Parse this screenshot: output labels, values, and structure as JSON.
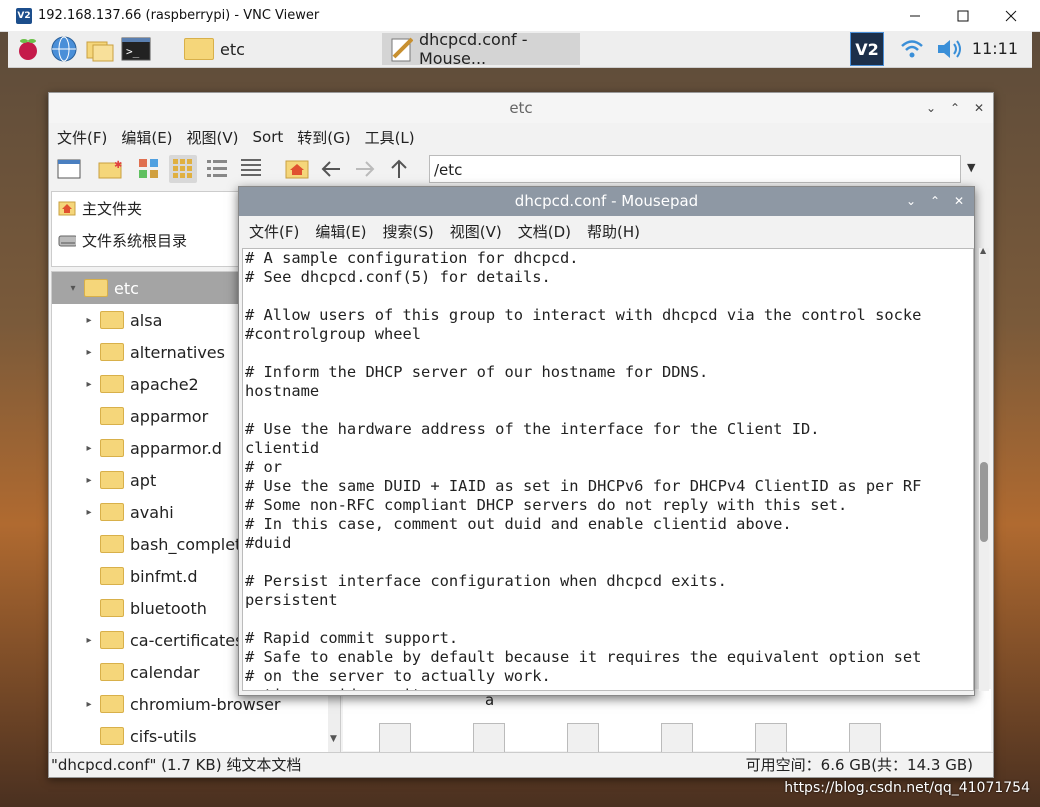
{
  "vnc": {
    "logo_text": "V2",
    "title": "192.168.137.66 (raspberrypi) - VNC Viewer"
  },
  "taskbar": {
    "folder_label": "etc",
    "active_task": "dhcpcd.conf - Mouse...",
    "clock": "11:11",
    "vnc_logo": "V2"
  },
  "file_manager": {
    "title": "etc",
    "menu": [
      "文件(F)",
      "编辑(E)",
      "视图(V)",
      "Sort",
      "转到(G)",
      "工具(L)"
    ],
    "path": "/etc",
    "places": [
      "主文件夹",
      "文件系统根目录"
    ],
    "tree": [
      {
        "label": "etc",
        "arrow": "▾",
        "selected": true
      },
      {
        "label": "alsa",
        "arrow": "▸"
      },
      {
        "label": "alternatives",
        "arrow": "▸"
      },
      {
        "label": "apache2",
        "arrow": "▸"
      },
      {
        "label": "apparmor",
        "arrow": ""
      },
      {
        "label": "apparmor.d",
        "arrow": "▸"
      },
      {
        "label": "apt",
        "arrow": "▸"
      },
      {
        "label": "avahi",
        "arrow": "▸"
      },
      {
        "label": "bash_completio",
        "arrow": ""
      },
      {
        "label": "binfmt.d",
        "arrow": ""
      },
      {
        "label": "bluetooth",
        "arrow": ""
      },
      {
        "label": "ca-certificates",
        "arrow": "▸"
      },
      {
        "label": "calendar",
        "arrow": ""
      },
      {
        "label": "chromium-browser",
        "arrow": "▸"
      },
      {
        "label": "cifs-utils",
        "arrow": ""
      }
    ],
    "file_label": "a",
    "status_left": "\"dhcpcd.conf\" (1.7 KB) 纯文本文档",
    "status_right": "可用空间：6.6 GB(共：14.3 GB)"
  },
  "mousepad": {
    "title": "dhcpcd.conf - Mousepad",
    "menu": [
      "文件(F)",
      "编辑(E)",
      "搜索(S)",
      "视图(V)",
      "文档(D)",
      "帮助(H)"
    ],
    "lines": [
      "# A sample configuration for dhcpcd.",
      "# See dhcpcd.conf(5) for details.",
      "",
      "# Allow users of this group to interact with dhcpcd via the control socke",
      "#controlgroup wheel",
      "",
      "# Inform the DHCP server of our hostname for DDNS.",
      "hostname",
      "",
      "# Use the hardware address of the interface for the Client ID.",
      "clientid",
      "# or",
      "# Use the same DUID + IAID as set in DHCPv6 for DHCPv4 ClientID as per RF",
      "# Some non-RFC compliant DHCP servers do not reply with this set.",
      "# In this case, comment out duid and enable clientid above.",
      "#duid",
      "",
      "# Persist interface configuration when dhcpcd exits.",
      "persistent",
      "",
      "# Rapid commit support.",
      "# Safe to enable by default because it requires the equivalent option set",
      "# on the server to actually work.",
      "option rapid_commit"
    ]
  },
  "watermark": "https://blog.csdn.net/qq_41071754"
}
